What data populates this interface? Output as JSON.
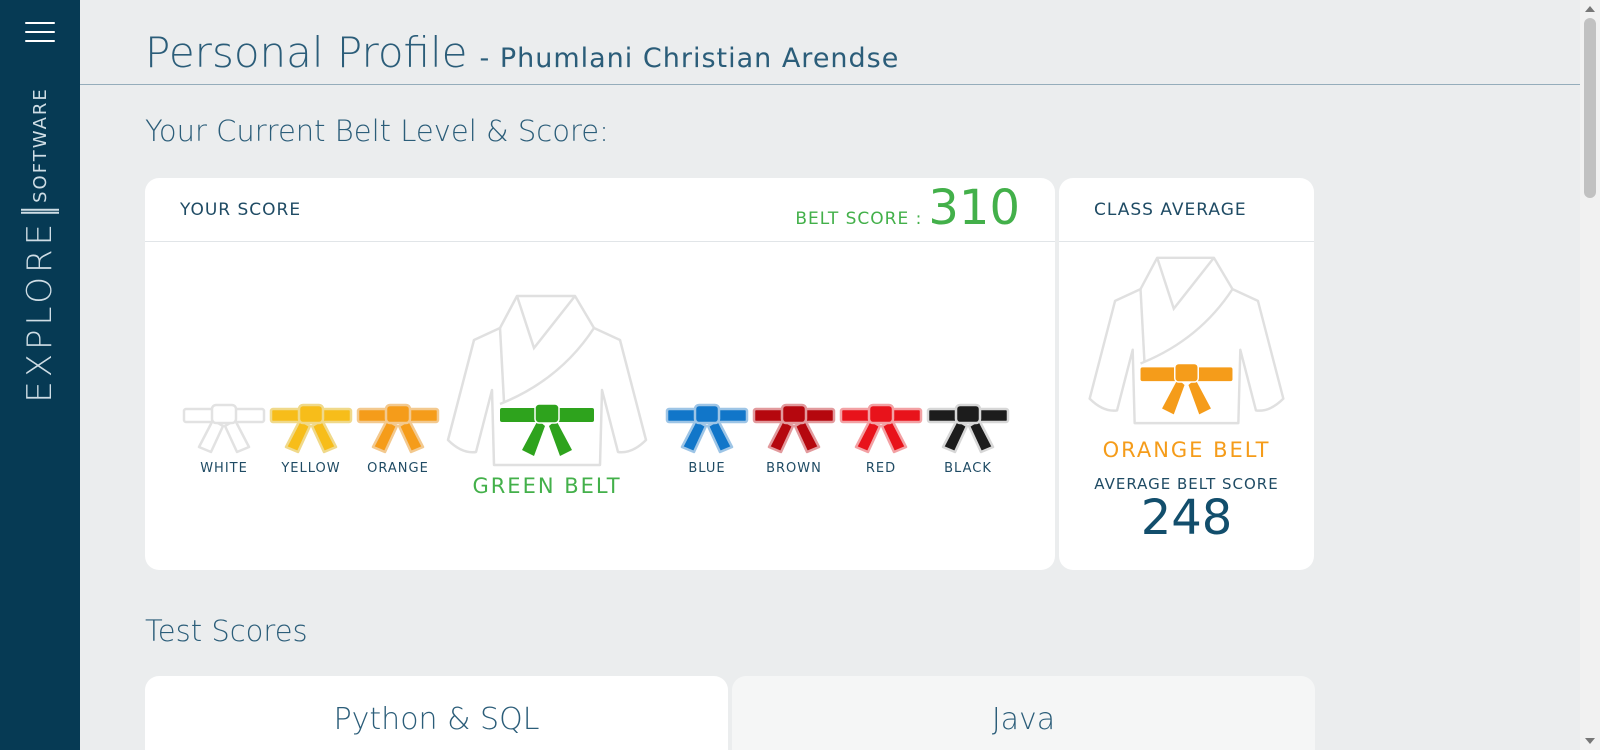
{
  "sidebar": {
    "menu_icon": "hamburger-menu-icon",
    "brand_explore": "EXPLORE",
    "brand_software": "SOFTWARE"
  },
  "header": {
    "title": "Personal Profile",
    "subtitle": "- Phumlani Christian Arendse"
  },
  "belt_section": {
    "heading": "Your Current Belt Level & Score:",
    "score_card": {
      "label": "YOUR SCORE",
      "belt_score_label": "BELT SCORE :",
      "belt_score_value": "310",
      "current_belt": "GREEN BELT",
      "current_belt_color": "#2ea31d",
      "belts": [
        {
          "name": "WHITE",
          "color": "#ffffff",
          "stroke": "#e2e2e2"
        },
        {
          "name": "YELLOW",
          "color": "#f7bd1a",
          "stroke": "#f0d98a"
        },
        {
          "name": "ORANGE",
          "color": "#f59c1a",
          "stroke": "#f3c98f"
        },
        {
          "name": "BLUE",
          "color": "#1176c9",
          "stroke": "#9ec5e6"
        },
        {
          "name": "BROWN",
          "color": "#b5070e",
          "stroke": "#e29a9d"
        },
        {
          "name": "RED",
          "color": "#e8131b",
          "stroke": "#f3a1a4"
        },
        {
          "name": "BLACK",
          "color": "#1c1c1c",
          "stroke": "#d7d7d7"
        }
      ]
    },
    "average_card": {
      "label": "CLASS AVERAGE",
      "belt_name": "ORANGE BELT",
      "belt_color": "#f59c1a",
      "average_label": "AVERAGE BELT SCORE",
      "average_value": "248"
    }
  },
  "test_scores": {
    "heading": "Test Scores",
    "cards": [
      {
        "title": "Python & SQL"
      },
      {
        "title": "Java"
      }
    ]
  },
  "colors": {
    "sidebar_bg": "#063a54",
    "page_bg": "#ebedee",
    "accent_green": "#43b04a",
    "accent_orange": "#f59c1a",
    "text_primary": "#2b5d79"
  }
}
